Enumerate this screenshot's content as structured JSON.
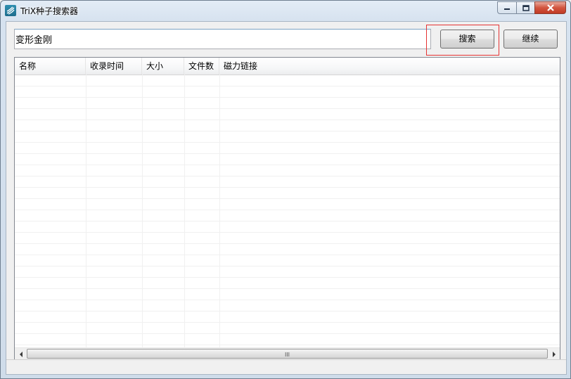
{
  "window": {
    "title": "TriX种子搜索器",
    "icons": [
      "app-icon",
      "minimize-icon",
      "maximize-icon",
      "close-icon"
    ]
  },
  "search": {
    "value": "变形金刚",
    "placeholder": ""
  },
  "toolbar": {
    "search_label": "搜索",
    "continue_label": "继续",
    "highlight_color": "#e53333"
  },
  "results": {
    "columns": [
      "名称",
      "收录时间",
      "大小",
      "文件数",
      "磁力链接"
    ],
    "rows": []
  },
  "scrollbar": {
    "grip": "III"
  },
  "statusbar": {
    "text": ""
  }
}
